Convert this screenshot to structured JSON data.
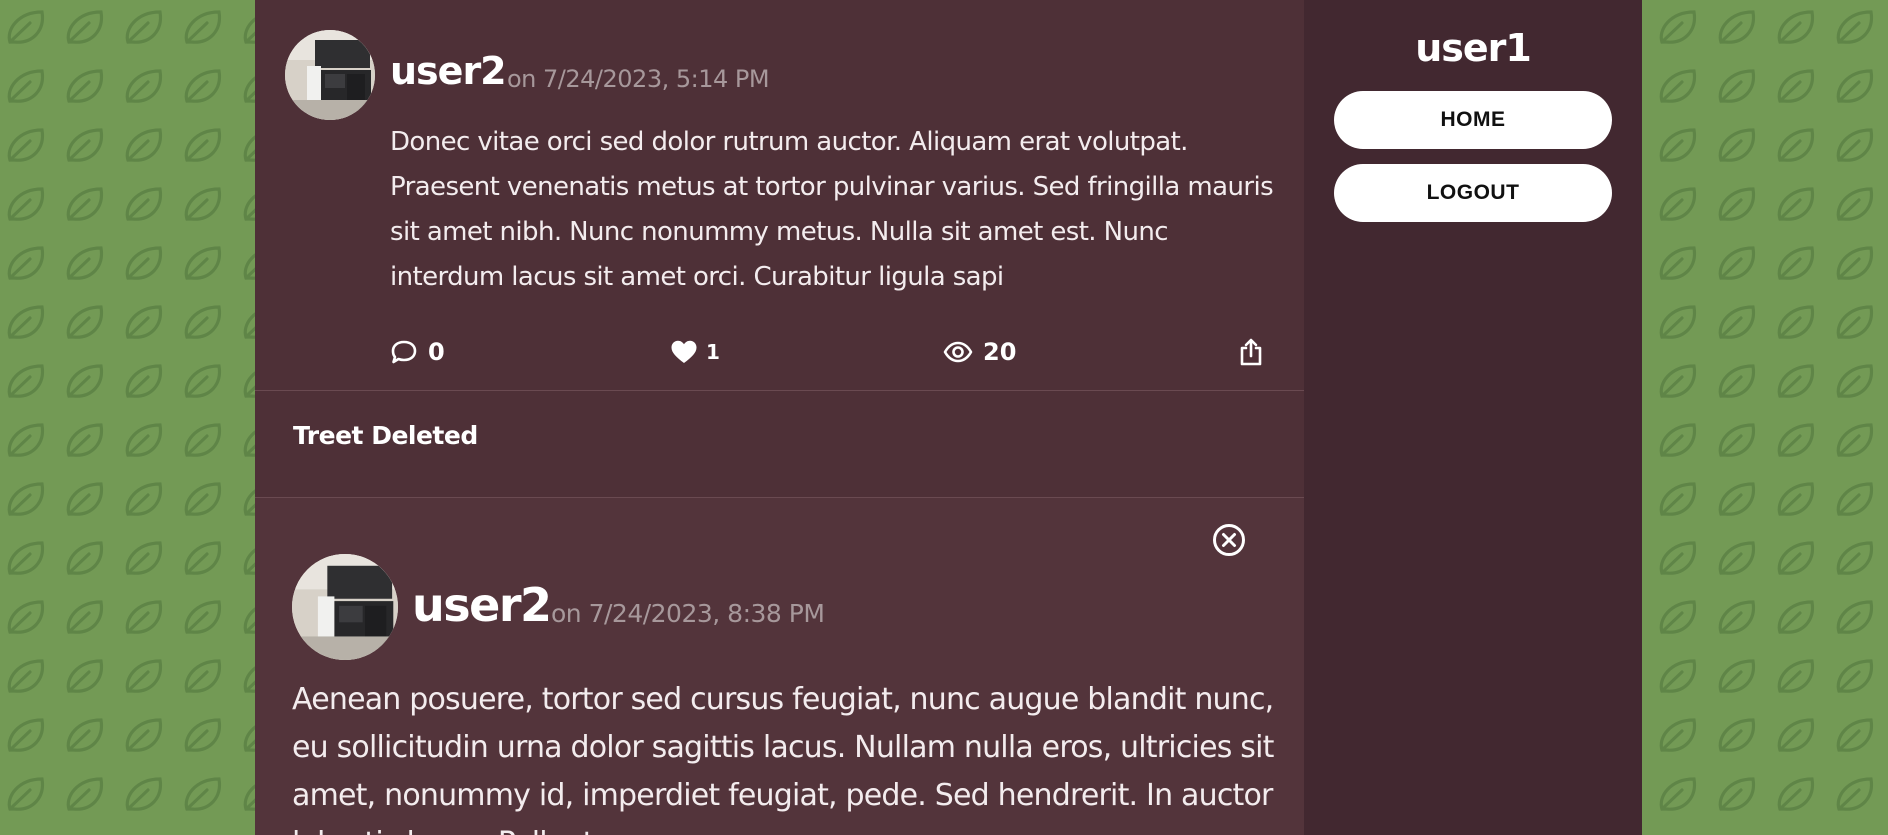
{
  "sidebar": {
    "username": "user1",
    "home_label": "HOME",
    "logout_label": "LOGOUT"
  },
  "feed": {
    "treet1": {
      "username": "user2",
      "date": "on 7/24/2023, 5:14 PM",
      "body": "Donec vitae orci sed dolor rutrum auctor. Aliquam erat volutpat. Praesent venenatis metus at tortor pulvinar varius. Sed fringilla mauris sit amet nibh. Nunc nonummy metus. Nulla sit amet est. Nunc interdum lacus sit amet orci. Curabitur ligula sapi",
      "comments": "0",
      "likes": "1",
      "views": "20"
    },
    "deleted_notice": "Treet Deleted",
    "treet2": {
      "username": "user2",
      "date": "on 7/24/2023, 8:38 PM",
      "body": "Aenean posuere, tortor sed cursus feugiat, nunc augue blandit nunc, eu sollicitudin urna dolor sagittis lacus. Nullam nulla eros, ultricies sit amet, nonummy id, imperdiet feugiat, pede. Sed hendrerit. In auctor lobortis lacus. Pellentesque posuere."
    }
  },
  "icons": {
    "comment": "comment-icon",
    "like": "heart-icon",
    "views": "eye-icon",
    "share": "share-icon",
    "close": "close-circle-icon",
    "background": "leaf-pattern"
  },
  "colors": {
    "background_green": "#739a55",
    "feed_bg": "#4e3037",
    "sidebar_bg": "#422830",
    "date_text": "#a7989b"
  }
}
